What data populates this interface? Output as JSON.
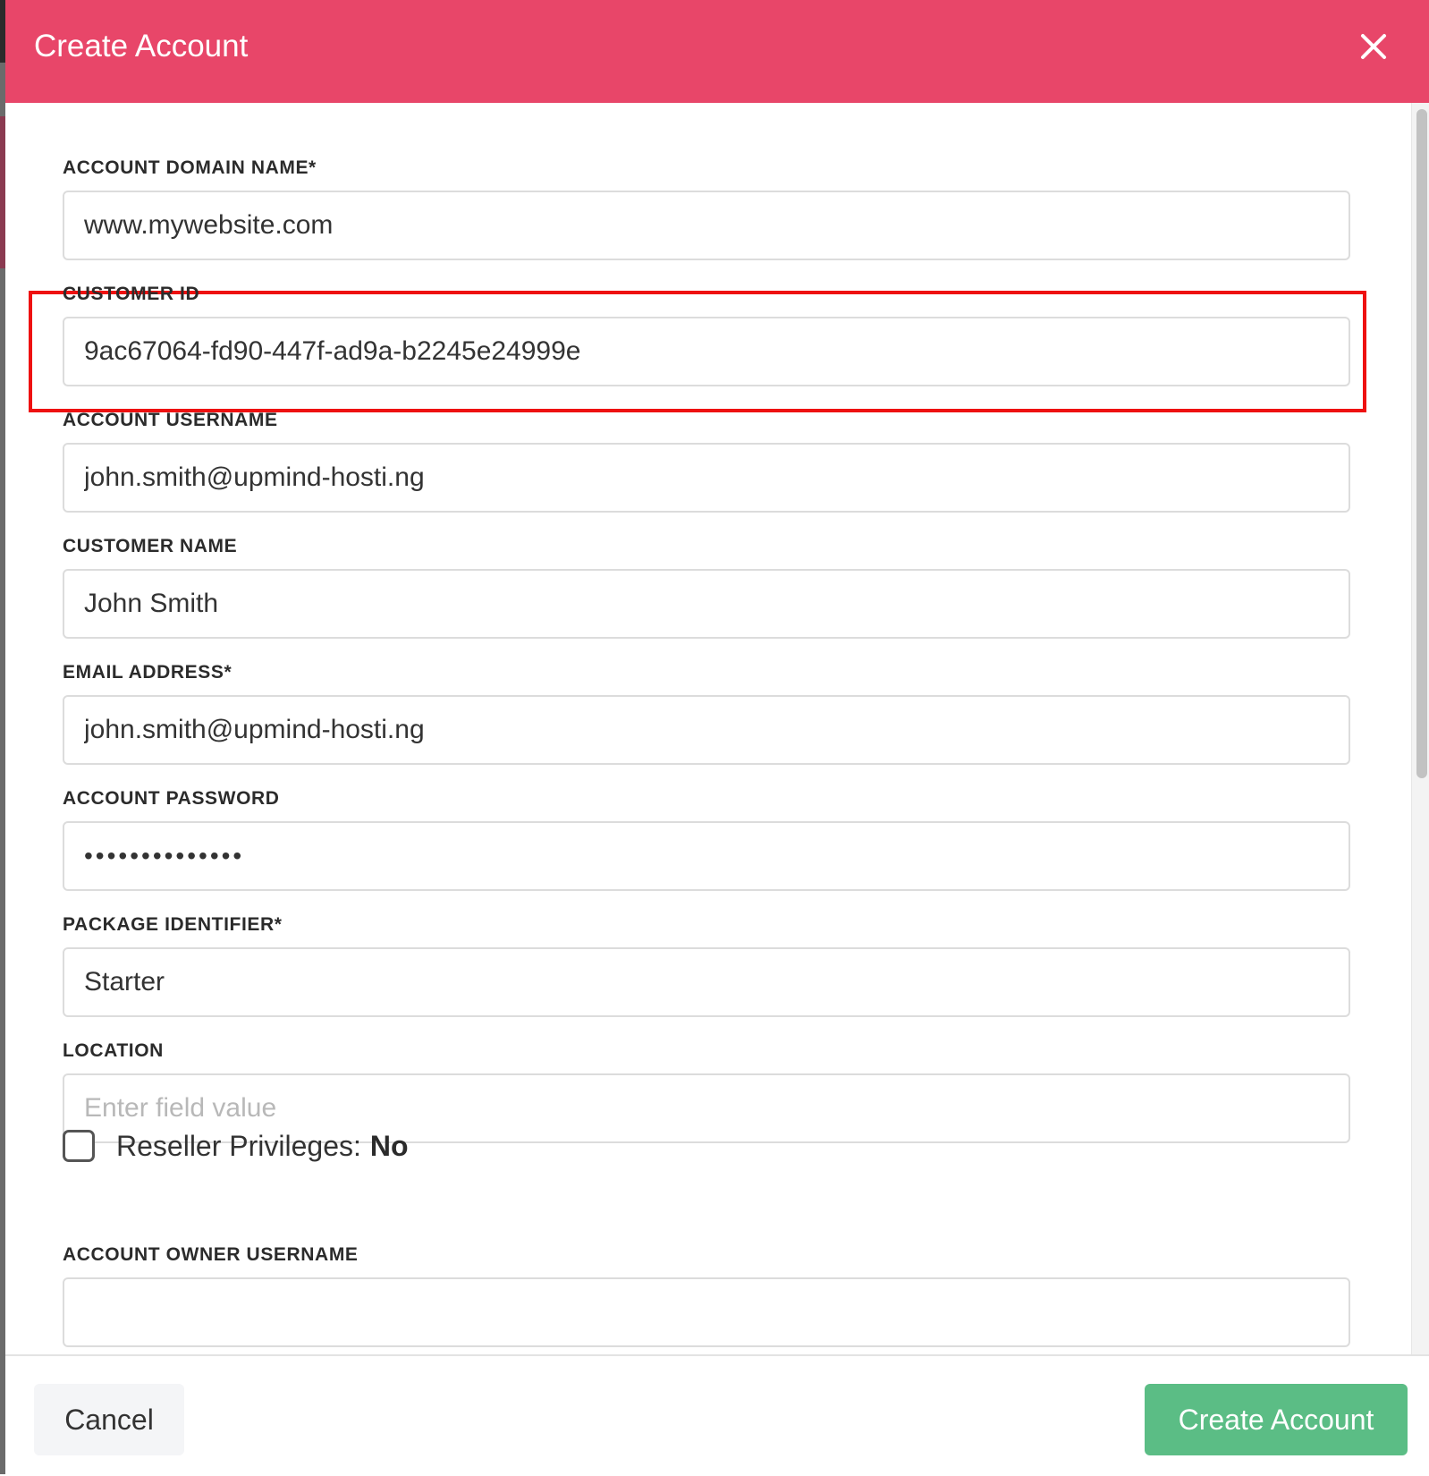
{
  "modal": {
    "title": "Create Account",
    "close_icon": "close-icon"
  },
  "fields": {
    "domain_name": {
      "label": "ACCOUNT DOMAIN NAME*",
      "value": "www.mywebsite.com"
    },
    "customer_id": {
      "label": "CUSTOMER ID",
      "value": "9ac67064-fd90-447f-ad9a-b2245e24999e"
    },
    "account_username": {
      "label": "ACCOUNT USERNAME",
      "value": "john.smith@upmind-hosti.ng"
    },
    "customer_name": {
      "label": "CUSTOMER NAME",
      "value": "John Smith"
    },
    "email_address": {
      "label": "EMAIL ADDRESS*",
      "value": "john.smith@upmind-hosti.ng"
    },
    "account_password": {
      "label": "ACCOUNT PASSWORD",
      "value": "passwordpasswo"
    },
    "package_identifier": {
      "label": "PACKAGE IDENTIFIER*",
      "value": "Starter"
    },
    "location": {
      "label": "LOCATION",
      "value": "",
      "placeholder": "Enter field value"
    },
    "account_owner_username": {
      "label": "ACCOUNT OWNER USERNAME",
      "value": ""
    }
  },
  "reseller": {
    "label": "Reseller Privileges:",
    "value": "No",
    "checked": false
  },
  "footer": {
    "cancel_label": "Cancel",
    "create_label": "Create Account"
  },
  "colors": {
    "header": "#e84669",
    "highlight": "#ee1111",
    "primary_button": "#5bbd85",
    "secondary_button": "#f4f5f7"
  }
}
